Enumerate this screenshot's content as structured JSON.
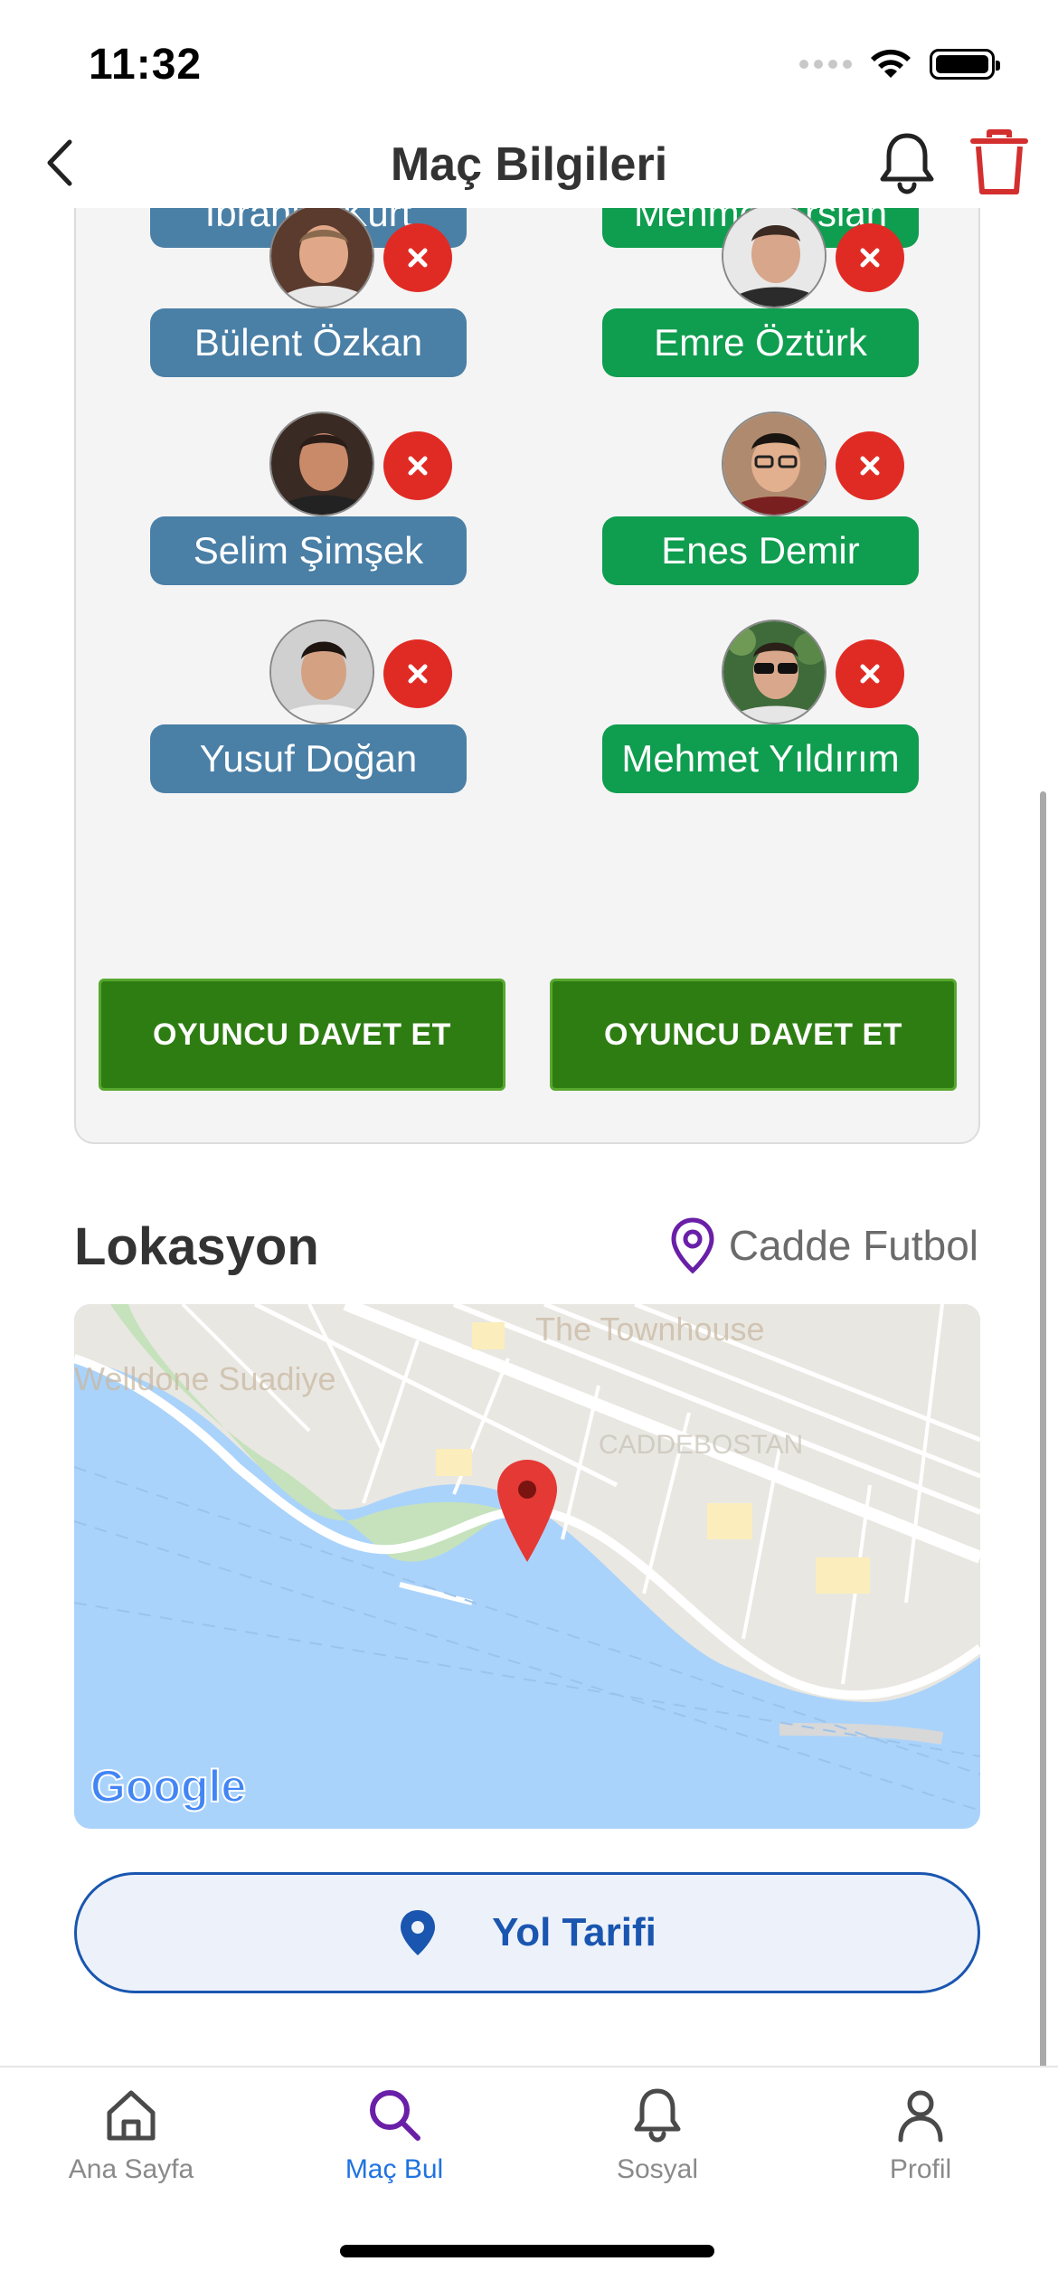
{
  "status_bar": {
    "time": "11:32"
  },
  "header": {
    "title": "Maç Bilgileri"
  },
  "players": {
    "team_a": [
      {
        "name": "İbrahim Kurt"
      },
      {
        "name": "Bülent Özkan"
      },
      {
        "name": "Selim Şimşek"
      },
      {
        "name": "Yusuf Doğan"
      }
    ],
    "team_b": [
      {
        "name": "Mehmet Arslan"
      },
      {
        "name": "Emre Öztürk"
      },
      {
        "name": "Enes Demir"
      },
      {
        "name": "Mehmet Yıldırım"
      }
    ],
    "invite_label_a": "OYUNCU DAVET ET",
    "invite_label_b": "OYUNCU DAVET ET"
  },
  "location": {
    "section_title": "Lokasyon",
    "venue": "Cadde Futbol",
    "map_labels": {
      "poi_1": "Welldone Suadiye",
      "poi_2": "The Townhouse",
      "district": "CADDEBOSTAN",
      "map_brand": "Google"
    }
  },
  "directions": {
    "label": "Yol Tarifi"
  },
  "tab_bar": {
    "items": [
      {
        "label": "Ana Sayfa",
        "icon": "home-icon",
        "active": false
      },
      {
        "label": "Maç Bul",
        "icon": "search-icon",
        "active": true
      },
      {
        "label": "Sosyal",
        "icon": "bell-icon",
        "active": false
      },
      {
        "label": "Profil",
        "icon": "person-icon",
        "active": false
      }
    ]
  },
  "colors": {
    "team_a": "#4a7fa6",
    "team_b": "#0f9d4f",
    "invite": "#2e7d12",
    "remove": "#e02b24",
    "accent": "#1a56b0",
    "active_tab": "#1f73e0",
    "tab_active_icon": "#6a1fa8",
    "delete": "#d32f2f"
  }
}
